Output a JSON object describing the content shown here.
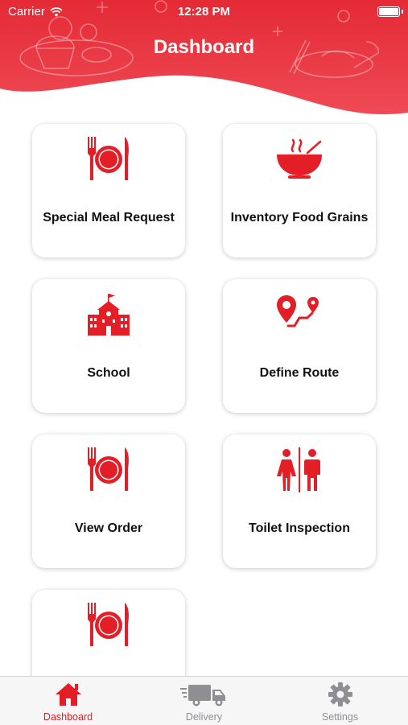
{
  "status_bar": {
    "carrier": "Carrier",
    "time": "12:28 PM"
  },
  "header": {
    "title": "Dashboard"
  },
  "colors": {
    "accent": "#e41e26",
    "header": "#e8323d",
    "tab_inactive": "#8e8e93"
  },
  "cards": [
    {
      "label": "Special Meal Request",
      "icon": "plate-cutlery-icon"
    },
    {
      "label": "Inventory Food Grains",
      "icon": "hot-bowl-icon"
    },
    {
      "label": "School",
      "icon": "school-building-icon"
    },
    {
      "label": "Define Route",
      "icon": "route-icon"
    },
    {
      "label": "View Order",
      "icon": "plate-cutlery-icon"
    },
    {
      "label": "Toilet Inspection",
      "icon": "restroom-icon"
    },
    {
      "label": "",
      "icon": "plate-cutlery-icon"
    }
  ],
  "tabs": [
    {
      "label": "Dashboard",
      "icon": "home-icon",
      "active": true
    },
    {
      "label": "Delivery",
      "icon": "truck-icon",
      "active": false
    },
    {
      "label": "Settings",
      "icon": "gear-icon",
      "active": false
    }
  ]
}
